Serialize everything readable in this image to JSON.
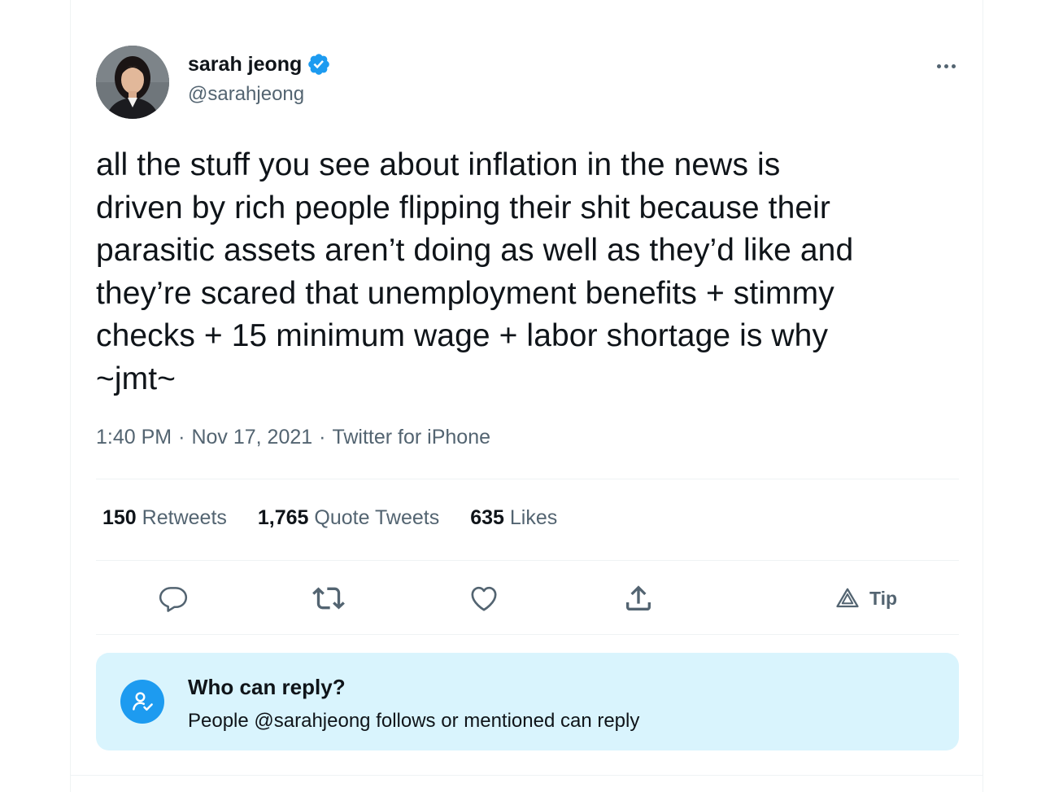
{
  "author": {
    "name": "sarah jeong",
    "handle": "@sarahjeong",
    "verified": true
  },
  "tweet": {
    "text": "all the stuff you see about inflation in the news is\ndriven by rich people flipping their shit because their\nparasitic assets aren’t doing as well as they’d like and\nthey’re scared that unemployment benefits + stimmy\nchecks + 15 minimum wage + labor shortage is why\n~jmt~",
    "time": "1:40 PM",
    "date": "Nov 17, 2021",
    "separator": "·",
    "source": "Twitter for iPhone"
  },
  "stats": {
    "retweets": {
      "count": "150",
      "label": "Retweets"
    },
    "quote_tweets": {
      "count": "1,765",
      "label": "Quote Tweets"
    },
    "likes": {
      "count": "635",
      "label": "Likes"
    }
  },
  "actions": {
    "reply_icon": "reply-icon",
    "retweet_icon": "retweet-icon",
    "like_icon": "heart-icon",
    "share_icon": "share-icon",
    "tip_icon": "tip-icon",
    "tip_label": "Tip"
  },
  "reply_settings": {
    "title": "Who can reply?",
    "description": "People @sarahjeong follows or mentioned can reply"
  },
  "colors": {
    "accent": "#1d9bf0",
    "text": "#0f1419",
    "secondary": "#536471",
    "reply_box_bg": "#d9f4fd"
  }
}
